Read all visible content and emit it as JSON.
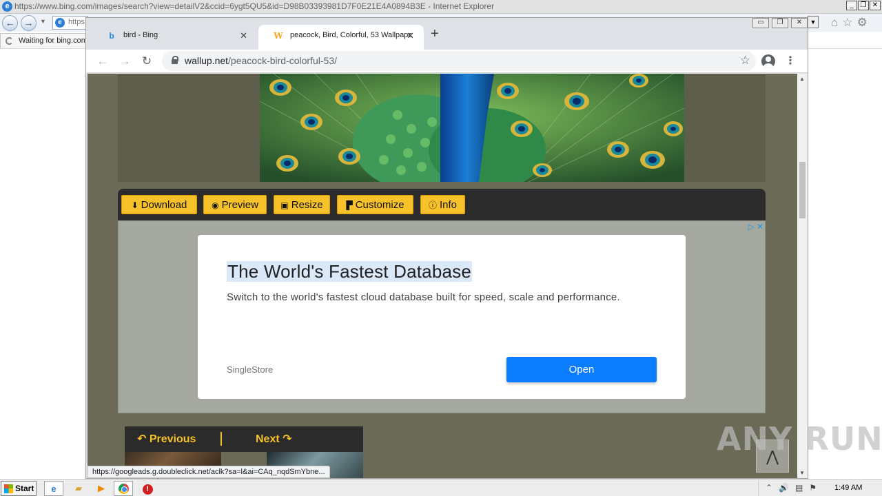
{
  "ie": {
    "title": "https://www.bing.com/images/search?view=detailV2&ccid=6ygt5QU5&id=D98B03393981D7F0E21E4A0894B3E - Internet Explorer",
    "address_value": "https",
    "tab_label": "Waiting for bing.com"
  },
  "chrome": {
    "tabs": [
      {
        "label": "bird - Bing",
        "favicon": "bing-icon"
      },
      {
        "label": "peacock, Bird, Colorful, 53 Wallpaper",
        "favicon": "wallup-icon"
      }
    ],
    "url_host": "wallup.net",
    "url_path": "/peacock-bird-colorful-53/",
    "status_url": "https://googleads.g.doubleclick.net/aclk?sa=l&ai=CAq_nqdSmYbne..."
  },
  "page": {
    "toolbar": {
      "download": "Download",
      "preview": "Preview",
      "resize": "Resize",
      "customize": "Customize",
      "info": "Info"
    },
    "ad": {
      "title": "The World's Fastest Database",
      "description": "Switch to the world's fastest cloud database built for speed, scale and performance.",
      "advertiser": "SingleStore",
      "cta": "Open"
    },
    "pager": {
      "previous": "Previous",
      "next": "Next"
    },
    "watermark": "ANY RUN"
  },
  "taskbar": {
    "start": "Start",
    "clock": "1:49 AM"
  },
  "colors": {
    "accent_yellow": "#f7c12a",
    "page_bg": "#6a6a56",
    "ad_button": "#0b7cff"
  }
}
